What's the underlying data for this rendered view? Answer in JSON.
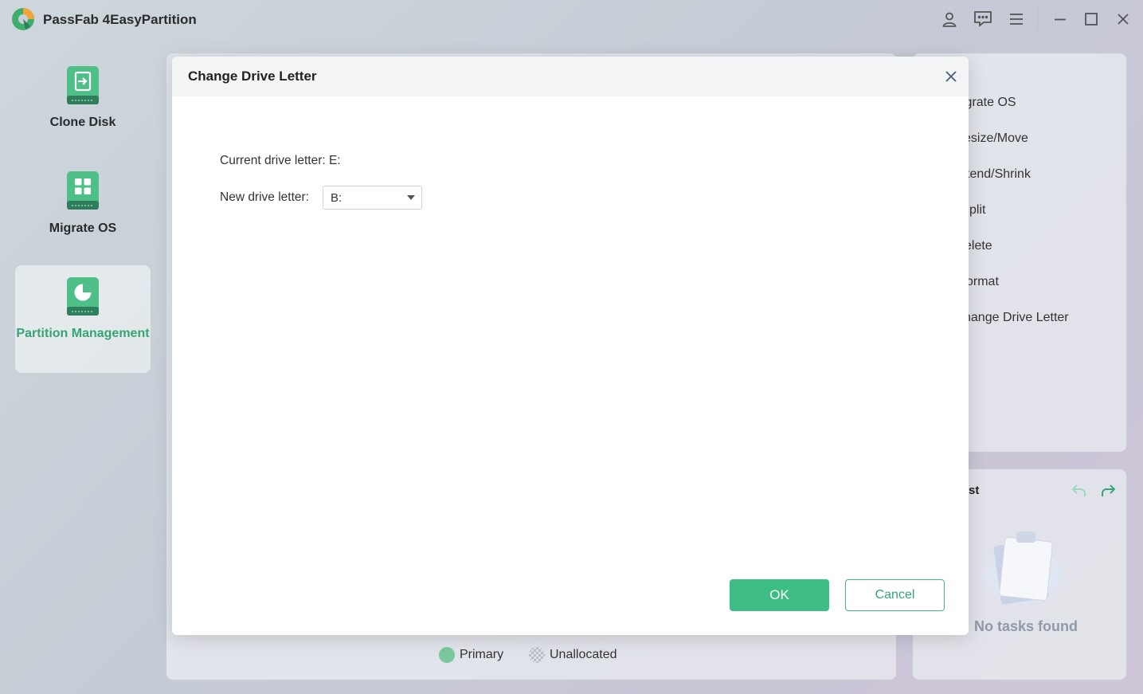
{
  "app": {
    "title": "PassFab 4EasyPartition"
  },
  "sidebar": {
    "items": [
      {
        "label": "Clone Disk",
        "icon": "clone-disk-icon"
      },
      {
        "label": "Migrate OS",
        "icon": "migrate-os-icon"
      },
      {
        "label": "Partition Management",
        "icon": "partition-management-icon",
        "active": true
      }
    ]
  },
  "right_menu": {
    "items": [
      "igrate OS",
      "esize/Move",
      "tend/Shrink",
      "plit",
      "elete",
      "ormat",
      "hange Drive Letter"
    ]
  },
  "tasks": {
    "title": "st",
    "empty_text": "No tasks found"
  },
  "legend": {
    "primary": "Primary",
    "unallocated": "Unallocated"
  },
  "dialog": {
    "title": "Change Drive Letter",
    "current_label": "Current drive letter: E:",
    "new_label": "New drive letter:",
    "new_value": "B:",
    "ok_label": "OK",
    "cancel_label": "Cancel"
  },
  "colors": {
    "accent": "#3dbd83",
    "accent_dark": "#35a574",
    "background": "#c8cfd8"
  }
}
